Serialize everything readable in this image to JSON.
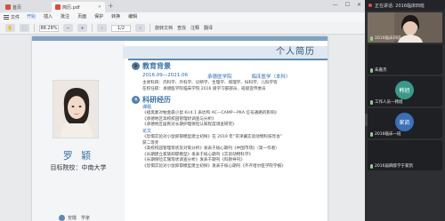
{
  "tabs": {
    "home_label": "首页",
    "doc_label": "简历.pdf"
  },
  "menu": {
    "file": "文件",
    "items": [
      "开始",
      "插入",
      "批注",
      "页面",
      "保护",
      "转换",
      "编辑"
    ],
    "active_index": 0
  },
  "toolbar": {
    "zoom": "88.28%",
    "page": "1/2",
    "labels": [
      "旋转文档",
      "查找",
      "注释",
      "翻译"
    ]
  },
  "resume": {
    "title": "个人简历",
    "name": "罗 颖",
    "target": "目标院校：中南大学",
    "education": {
      "heading": "教育背景",
      "dates": "2016.09—2021.06",
      "school": "承德医学院",
      "major": "临床医学（本科）",
      "bullets": [
        "主修科目：内科学、外科学、诊断学、生理学、病理学、妇科学、儿科学等",
        "在校任职：承德医学院临床学院 2016 级学习部部员、班级宣传委员"
      ]
    },
    "research": {
      "heading": "科研经历",
      "sub_topics": "课题",
      "topics": [
        "《褪黑素对帕金森小鼠 Kir4.1 表达和 AC—CAMP—PKA 信号通路的影响》",
        "《承德地区高校校园管理状调查与分析》",
        "《承德地区居民对长期护理保险认知程度调查研究》"
      ],
      "sub_papers": "论文",
      "papers": [
        "《恐惧实验对小鼠抑郁模型建立初探》在 2019 年“京津冀实验动物科技年会”",
        "获二等奖",
        "《高校校园管理现状及对策分析》发表于核心期刊《中国市场》（第一作者）",
        "《长期建立家族抑郁模型》发表于核心期刊《实验动物科学》",
        "《长期保险实施现状调查分析》发表于期刊《科教导刊》",
        "《恐惧实验对小鼠抑郁模型建立初探》发表于核心期刊《齐齐哈尔医学院学报》"
      ]
    },
    "contact_label": "安徽　学家"
  },
  "meeting": {
    "header": "正在讲话: 2016临床四班",
    "participants": [
      {
        "name": "2016临床四班",
        "initials": "",
        "color": "#5a5148",
        "camera": true
      },
      {
        "name": "朱嘉杰",
        "initials": "",
        "color": "#2a2b2f",
        "camera": false
      },
      {
        "name": "工作人员—韩旭",
        "initials": "韩旭",
        "color": "#3a9a8a",
        "camera": false
      },
      {
        "name": "2016临床一班",
        "initials": "家凯",
        "color": "#3d6fb8",
        "camera": false
      },
      {
        "name": "2016届麻醉学于家凯",
        "initials": "",
        "color": "#2a2b2f",
        "camera": false
      }
    ]
  },
  "colors": {
    "accent": "#3c73a8",
    "link_blue": "#2a6bb0"
  }
}
